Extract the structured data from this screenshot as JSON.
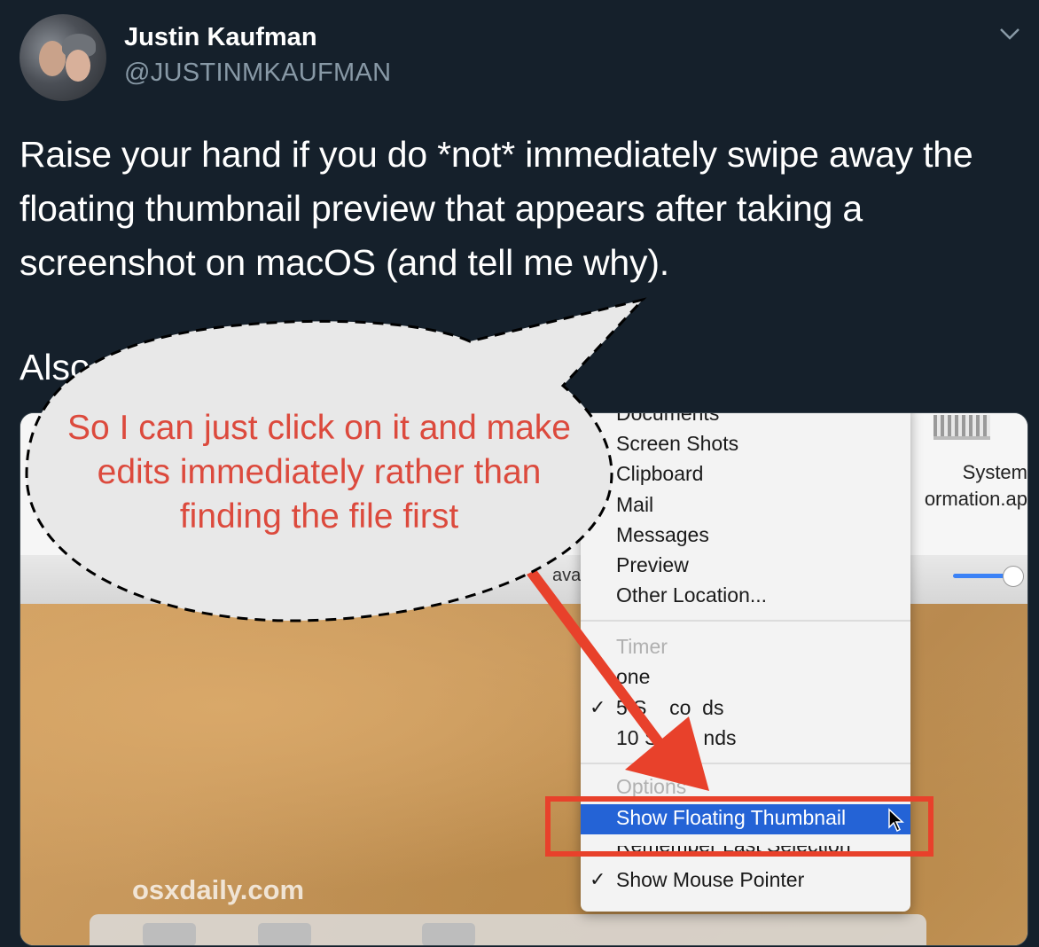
{
  "tweet": {
    "author_name": "Justin Kaufman",
    "author_handle": "@JUSTINMKAUFMAN",
    "text": "Raise your hand if you do *not* immediately swipe away the floating thumbnail preview that appears after taking a screenshot on macOS (and tell me why).",
    "text_continuation": "Also, I"
  },
  "screenshot": {
    "desktop_icon_label": "System\normation.ap",
    "partial_label": "ava",
    "watermark": "osxdaily.com",
    "menu": {
      "save_to_items": [
        "Documents",
        "Screen Shots",
        "Clipboard",
        "Mail",
        "Messages",
        "Preview",
        "Other Location..."
      ],
      "timer_header": "Timer",
      "timer_items": [
        {
          "label": "None",
          "checked": false,
          "display": "one"
        },
        {
          "label": "5 Seconds",
          "checked": true,
          "display": "5 S    co  ds"
        },
        {
          "label": "10 Seconds",
          "checked": false,
          "display": "10 S        nds"
        }
      ],
      "options_header": "Options",
      "highlighted_item": "Show Floating Thumbnail",
      "partial_item": "Remember Last Selection",
      "last_item": "Show Mouse Pointer"
    }
  },
  "annotation": {
    "bubble_text": "So I can just click on it and make edits immediately rather than finding the file first",
    "accent_color": "#e8412b"
  },
  "icons": [
    "chevron-down-icon",
    "checkmark-icon",
    "mouse-cursor-icon"
  ]
}
